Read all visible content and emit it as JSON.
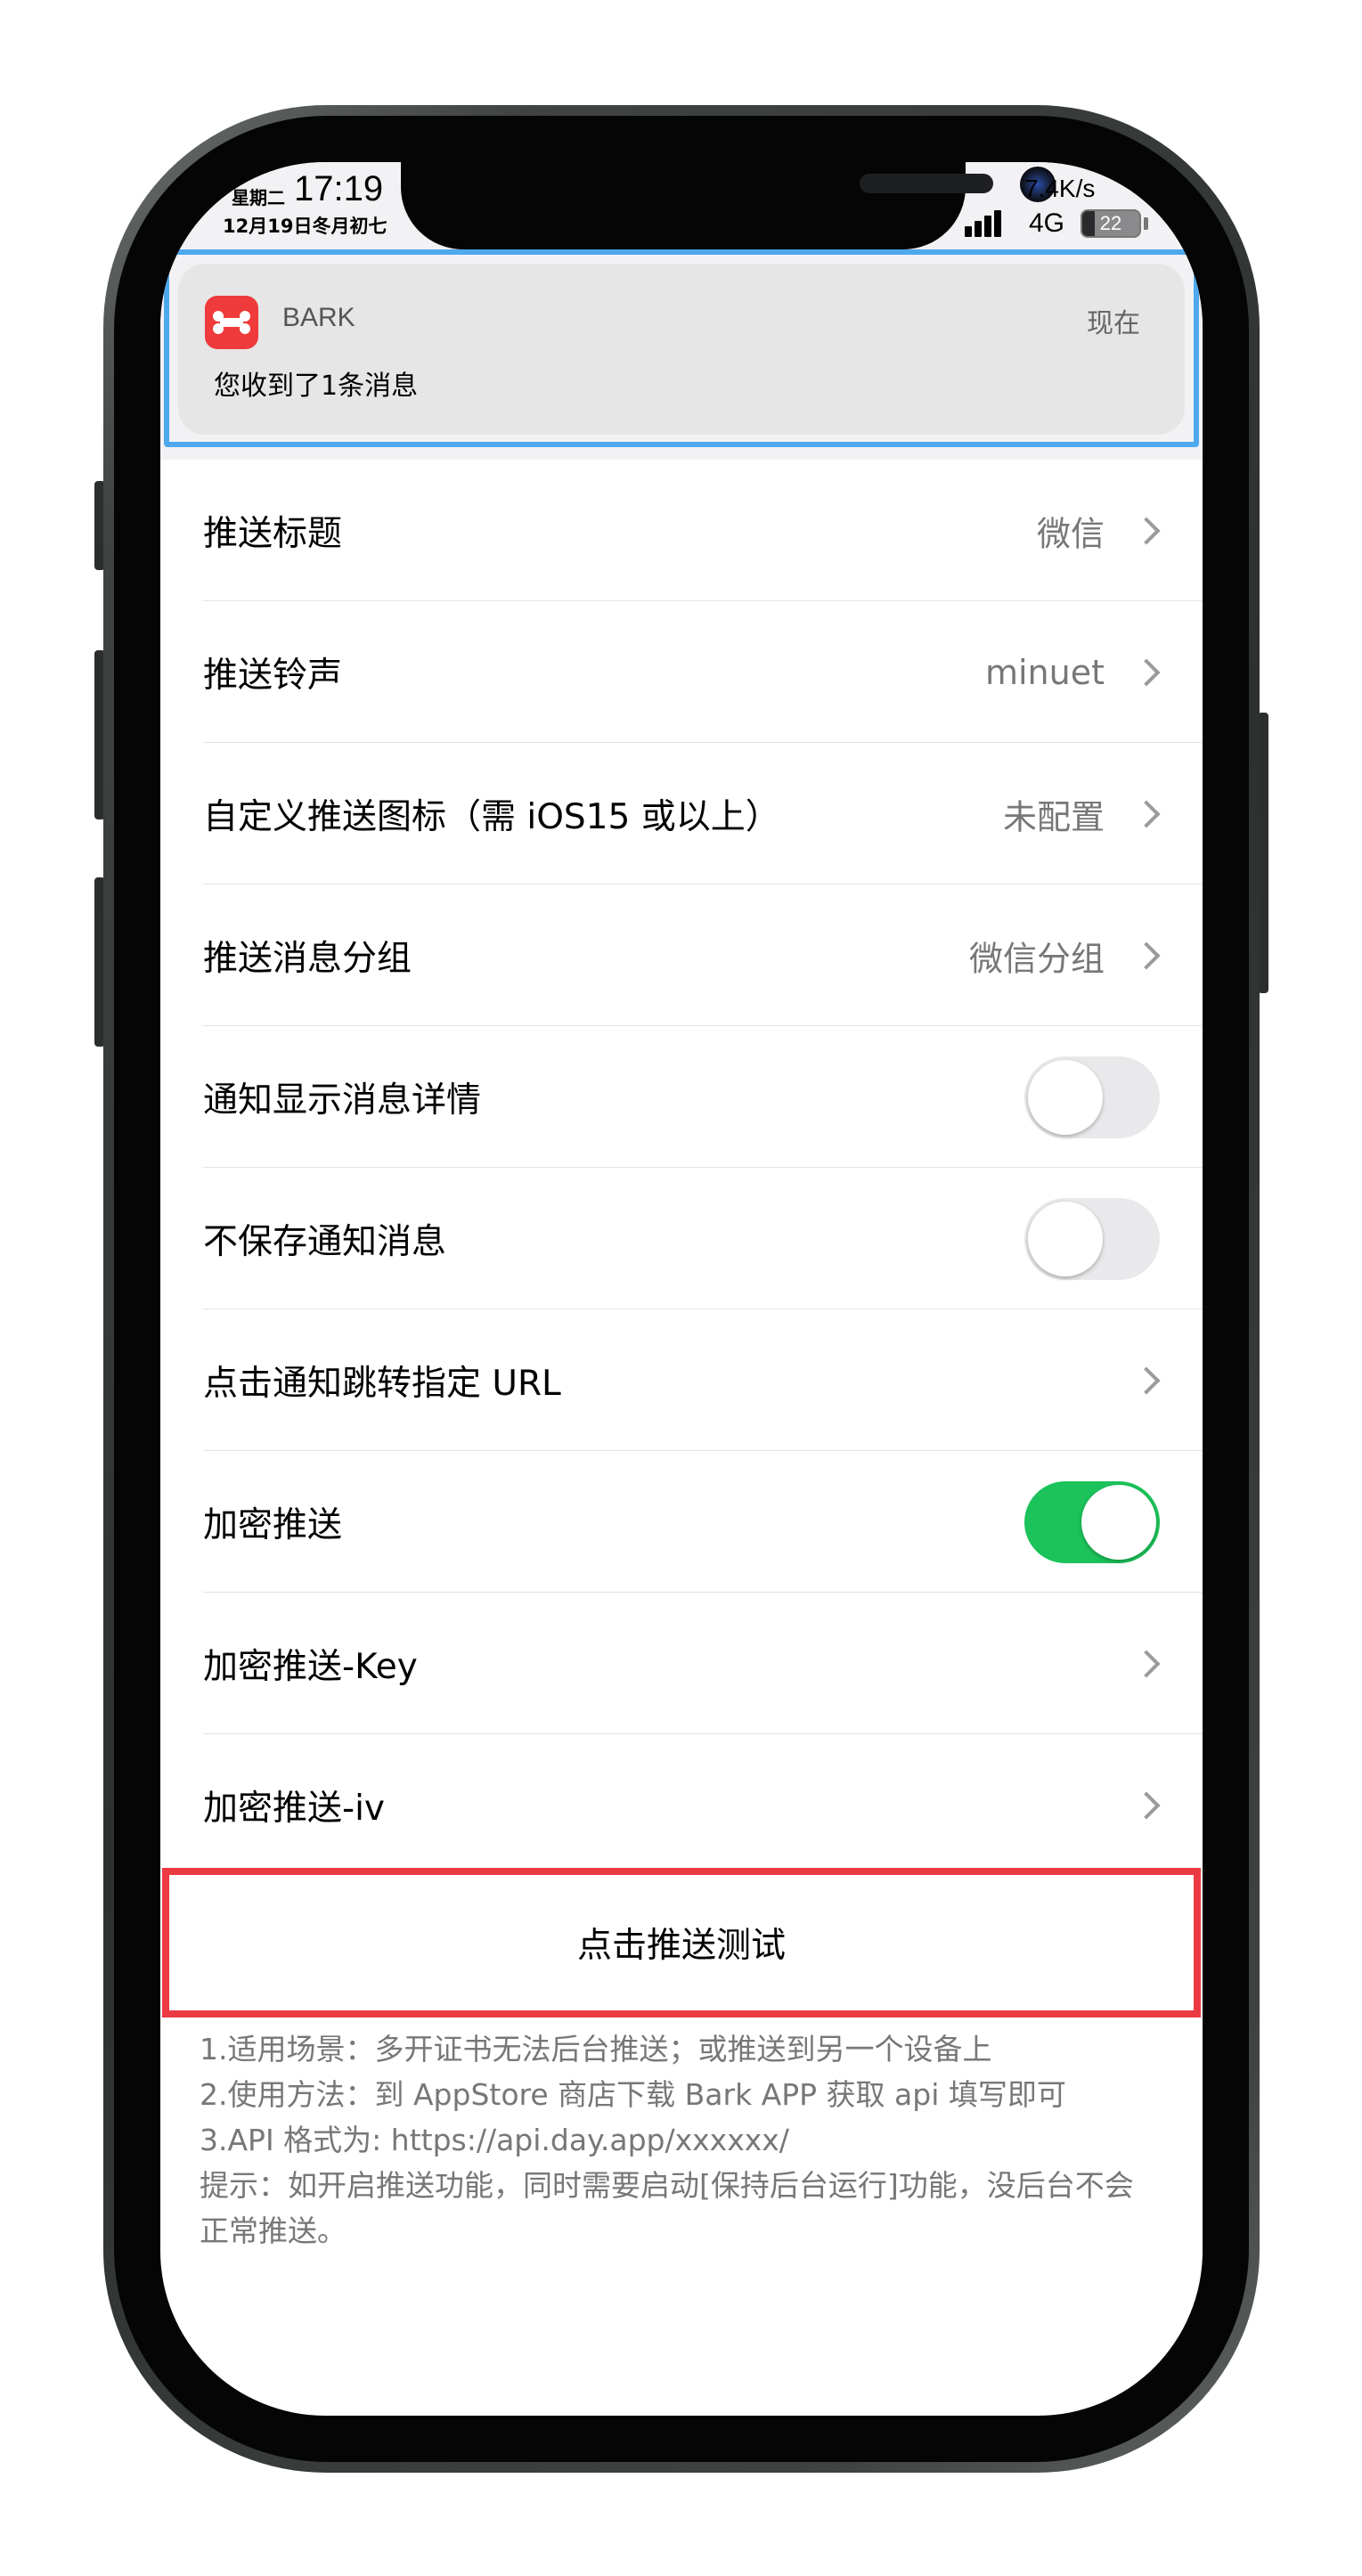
{
  "status_bar": {
    "weekday": "星期二",
    "time": "17:19",
    "lunar_date": "12月19日冬月初七",
    "net_speed": "7.4K/s",
    "network": "4G",
    "battery_level": "22",
    "battery_fraction": 0.22
  },
  "notification": {
    "app_icon": "bark-bone-icon",
    "app_name": "BARK",
    "time": "现在",
    "message": "您收到了1条消息",
    "highlight_color": "#4da8ee"
  },
  "settings": [
    {
      "label": "推送标题",
      "value": "微信",
      "type": "link"
    },
    {
      "label": "推送铃声",
      "value": "minuet",
      "type": "link"
    },
    {
      "label": "自定义推送图标（需 iOS15 或以上）",
      "value": "未配置",
      "type": "link"
    },
    {
      "label": "推送消息分组",
      "value": "微信分组",
      "type": "link"
    },
    {
      "label": "通知显示消息详情",
      "type": "toggle",
      "on": false
    },
    {
      "label": "不保存通知消息",
      "type": "toggle",
      "on": false
    },
    {
      "label": "点击通知跳转指定 URL",
      "value": "",
      "type": "link"
    },
    {
      "label": "加密推送",
      "type": "toggle",
      "on": true
    },
    {
      "label": "加密推送-Key",
      "value": "",
      "type": "link"
    },
    {
      "label": "加密推送-iv",
      "value": "",
      "type": "link"
    }
  ],
  "test_button": {
    "label": "点击推送测试",
    "highlight_color": "#ec3a43"
  },
  "notes": [
    "1.适用场景：多开证书无法后台推送；或推送到另一个设备上",
    "2.使用方法：到 AppStore 商店下载 Bark APP 获取 api 填写即可",
    "3.API 格式为: https://api.day.app/xxxxxx/",
    "提示：如开启推送功能，同时需要启动[保持后台运行]功能，没后台不会",
    "正常推送。"
  ],
  "colors": {
    "toggle_on": "#1bc35a",
    "toggle_off": "#e9e9eb",
    "secondary_text": "#777777"
  }
}
